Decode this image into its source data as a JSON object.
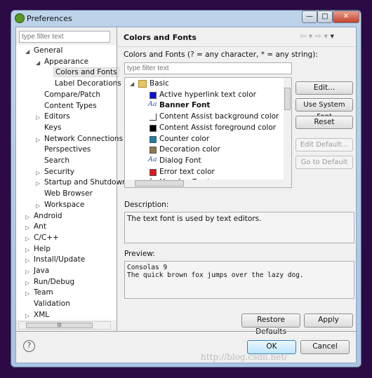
{
  "window": {
    "title": "Preferences",
    "minimize": "—",
    "maximize": "□",
    "close": "✕"
  },
  "sidebar": {
    "filter_placeholder": "type filter text",
    "items": [
      {
        "label": "General",
        "level": 0,
        "expanded": true
      },
      {
        "label": "Appearance",
        "level": 1,
        "expanded": true
      },
      {
        "label": "Colors and Fonts",
        "level": 2,
        "selected": true
      },
      {
        "label": "Label Decorations",
        "level": 2
      },
      {
        "label": "Compare/Patch",
        "level": 1
      },
      {
        "label": "Content Types",
        "level": 1
      },
      {
        "label": "Editors",
        "level": 1,
        "collapsed": true
      },
      {
        "label": "Keys",
        "level": 1
      },
      {
        "label": "Network Connections",
        "level": 1,
        "collapsed": true
      },
      {
        "label": "Perspectives",
        "level": 1
      },
      {
        "label": "Search",
        "level": 1
      },
      {
        "label": "Security",
        "level": 1,
        "collapsed": true
      },
      {
        "label": "Startup and Shutdown",
        "level": 1,
        "collapsed": true
      },
      {
        "label": "Web Browser",
        "level": 1
      },
      {
        "label": "Workspace",
        "level": 1,
        "collapsed": true
      },
      {
        "label": "Android",
        "level": 0,
        "collapsed": true
      },
      {
        "label": "Ant",
        "level": 0,
        "collapsed": true
      },
      {
        "label": "C/C++",
        "level": 0,
        "collapsed": true
      },
      {
        "label": "Help",
        "level": 0,
        "collapsed": true
      },
      {
        "label": "Install/Update",
        "level": 0,
        "collapsed": true
      },
      {
        "label": "Java",
        "level": 0,
        "collapsed": true
      },
      {
        "label": "Run/Debug",
        "level": 0,
        "collapsed": true
      },
      {
        "label": "Team",
        "level": 0,
        "collapsed": true
      },
      {
        "label": "Validation",
        "level": 0
      },
      {
        "label": "XML",
        "level": 0,
        "collapsed": true
      }
    ]
  },
  "main": {
    "header": "Colors and Fonts",
    "filter_label": "Colors and Fonts (? = any character, * = any string):",
    "filter_placeholder": "type filter text",
    "root": "Basic",
    "entries": [
      {
        "label": "Active hyperlink text color",
        "type": "color",
        "color": "#0a14d8"
      },
      {
        "label": "Banner Font",
        "type": "font",
        "bold": true
      },
      {
        "label": "Content Assist background color",
        "type": "color",
        "color": "#ffffff"
      },
      {
        "label": "Content Assist foreground color",
        "type": "color",
        "color": "#000000"
      },
      {
        "label": "Counter color",
        "type": "color",
        "color": "#1a7fa8"
      },
      {
        "label": "Decoration color",
        "type": "color",
        "color": "#917a4a"
      },
      {
        "label": "Dialog Font",
        "type": "font"
      },
      {
        "label": "Error text color",
        "type": "color",
        "color": "#e0161a"
      },
      {
        "label": "Header Font",
        "type": "font",
        "bold": true
      }
    ],
    "font_icon": "Aa",
    "buttons": {
      "edit": "Edit...",
      "use_system_font": "Use System Font",
      "reset": "Reset",
      "edit_default": "Edit Default...",
      "go_to_default": "Go to Default"
    },
    "description_label": "Description:",
    "description": "The text font is used by text editors.",
    "preview_label": "Preview:",
    "preview_lines": [
      "Consolas 9",
      "The quick brown fox jumps over the lazy dog."
    ],
    "restore_defaults": "Restore Defaults",
    "apply": "Apply"
  },
  "footer": {
    "ok": "OK",
    "cancel": "Cancel",
    "help": "?"
  },
  "watermark": "http://blog.csdn.net/"
}
